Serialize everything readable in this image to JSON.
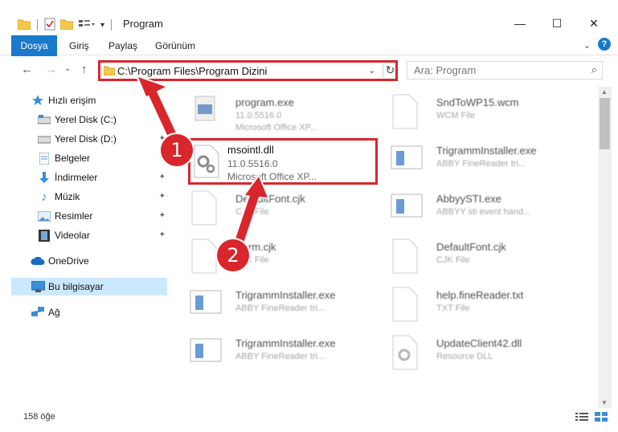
{
  "window": {
    "title": "Program",
    "minimize_glyph": "—",
    "maximize_glyph": "☐",
    "close_glyph": "✕"
  },
  "ribbon": {
    "tabs": [
      "Dosya",
      "Giriş",
      "Paylaş",
      "Görünüm"
    ],
    "collapse_glyph": "⌄",
    "help_glyph": "?"
  },
  "address": {
    "path": "C:\\Program Files\\Program Dizini",
    "dropdown_glyph": "⌄",
    "refresh_glyph": "↻"
  },
  "nav": {
    "back_glyph": "←",
    "forward_glyph": "→",
    "recent_glyph": "⌄",
    "up_glyph": "↑"
  },
  "search": {
    "placeholder": "Ara: Program",
    "icon": "search-icon"
  },
  "sidebar": {
    "items": [
      {
        "label": "Hızlı erişim",
        "icon": "star-icon",
        "pinned": false
      },
      {
        "label": "Yerel Disk (C:)",
        "icon": "drive-icon",
        "pinned": false
      },
      {
        "label": "Yerel Disk (D:)",
        "icon": "drive-icon",
        "pinned": true
      },
      {
        "label": "Belgeler",
        "icon": "documents-icon",
        "pinned": true
      },
      {
        "label": "İndirmeler",
        "icon": "download-icon",
        "pinned": true
      },
      {
        "label": "Müzik",
        "icon": "music-icon",
        "pinned": true
      },
      {
        "label": "Resimler",
        "icon": "pictures-icon",
        "pinned": true
      },
      {
        "label": "Videolar",
        "icon": "video-icon",
        "pinned": true
      },
      {
        "label": "OneDrive",
        "icon": "cloud-icon",
        "pinned": false
      },
      {
        "label": "Bu bilgisayar",
        "icon": "computer-icon",
        "pinned": false,
        "selected": true
      },
      {
        "label": "Ağ",
        "icon": "network-icon",
        "pinned": false
      }
    ],
    "pin_glyph": "📌"
  },
  "files": {
    "left": [
      {
        "name": "program.exe",
        "line2": "11.0.5516.0",
        "line3": "Microsoft Office XP...",
        "kind": "exe"
      },
      {
        "name": "DefaultFont.cjk",
        "line2": "CJK File",
        "line3": "",
        "kind": "doc"
      },
      {
        "name": "Korm.cjk",
        "line2": "CJK File",
        "line3": "",
        "kind": "doc"
      },
      {
        "name": "TrigrammInstaller.exe",
        "line2": "ABBY FineReader tri...",
        "line3": "",
        "kind": "app"
      },
      {
        "name": "TrigrammInstaller.exe",
        "line2": "ABBY FineReader tri...",
        "line3": "",
        "kind": "app"
      }
    ],
    "right": [
      {
        "name": "SndToWP15.wcm",
        "line2": "WCM File",
        "line3": "",
        "kind": "doc"
      },
      {
        "name": "TrigrammInstaller.exe",
        "line2": "ABBY FineReader tri...",
        "line3": "",
        "kind": "app"
      },
      {
        "name": "AbbyySTI.exe",
        "line2": "ABBYY sti event hand...",
        "line3": "",
        "kind": "app"
      },
      {
        "name": "DefaultFont.cjk",
        "line2": "CJK File",
        "line3": "",
        "kind": "doc"
      },
      {
        "name": "help.fineReader.txt",
        "line2": "TXT File",
        "line3": "",
        "kind": "doc"
      },
      {
        "name": "UpdateClient42.dll",
        "line2": "Resource DLL",
        "line3": "",
        "kind": "gear"
      }
    ],
    "highlighted": {
      "name": "msointl.dll",
      "line2": "11.0.5516.0",
      "line3": "Microsoft Office XP...",
      "kind": "gear"
    }
  },
  "annotations": {
    "step1": "1",
    "step2": "2",
    "color": "#d9262c"
  },
  "status": {
    "count": "158 öğe"
  },
  "colors": {
    "accent": "#1979ca",
    "highlight_border": "#d9262c",
    "selection": "#cce8ff"
  }
}
